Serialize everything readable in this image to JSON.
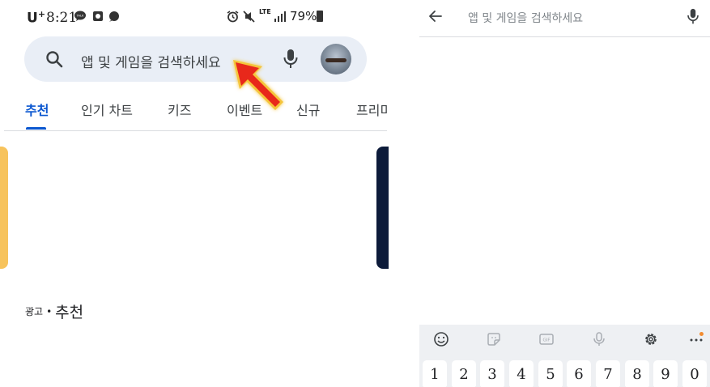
{
  "left_screen": {
    "status_bar": {
      "carrier": "U",
      "carrier_sup": "+",
      "time": "8:21",
      "lte": "LTE",
      "battery": "79%"
    },
    "search": {
      "placeholder": "앱 및 게임을 검색하세요",
      "search_icon": "search-icon",
      "mic_icon": "mic-icon"
    },
    "tabs": [
      {
        "label": "추천",
        "active": true
      },
      {
        "label": "인기 차트",
        "active": false
      },
      {
        "label": "키즈",
        "active": false
      },
      {
        "label": "이벤트",
        "active": false
      },
      {
        "label": "신규",
        "active": false
      },
      {
        "label": "프리미",
        "active": false
      }
    ],
    "annotation_arrow_color": "#e8281b",
    "ad_section": {
      "ad_label": "광고",
      "separator": "•",
      "title": "추천"
    }
  },
  "right_screen": {
    "search": {
      "placeholder": "앱 및 게임을 검색하세요",
      "back_icon": "arrow-back-icon",
      "mic_icon": "mic-icon"
    },
    "keyboard": {
      "toolbar": [
        "emoji-icon",
        "sticker-icon",
        "gif-icon",
        "voice-icon",
        "settings-icon",
        "more-icon"
      ],
      "gif_label": "GIF",
      "number_keys": [
        "1",
        "2",
        "3",
        "4",
        "5",
        "6",
        "7",
        "8",
        "9",
        "0"
      ]
    }
  },
  "colors": {
    "accent": "#0b57d0",
    "search_bg": "#e9eef6",
    "card_left": "#f7c35c",
    "card_right": "#0d1b3a"
  }
}
